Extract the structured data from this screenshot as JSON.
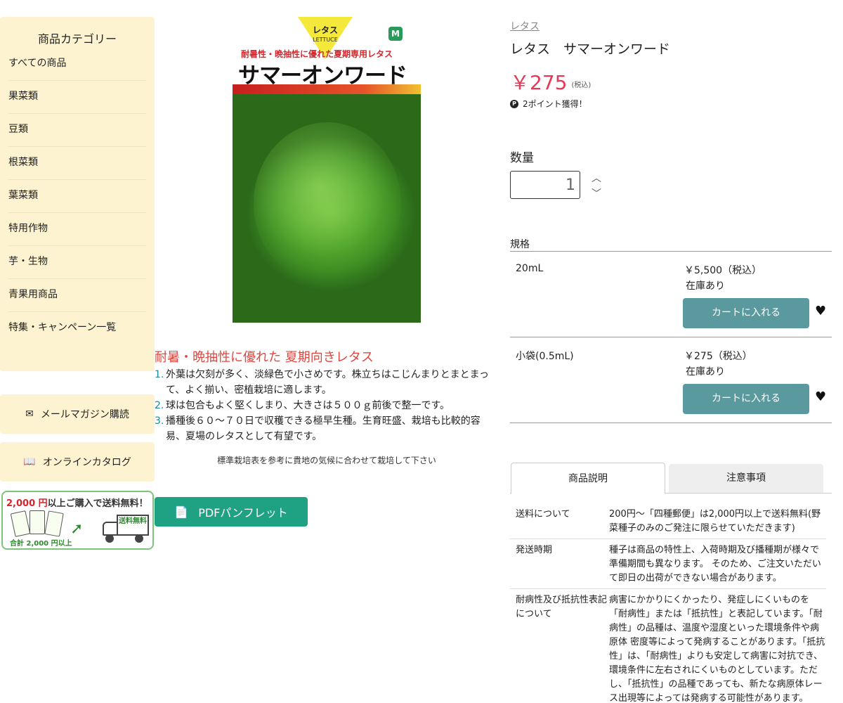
{
  "sidebar": {
    "title": "商品カテゴリー",
    "items": [
      "すべての商品",
      "果菜類",
      "豆類",
      "根菜類",
      "葉菜類",
      "特用作物",
      "芋・生物",
      "青果用商品",
      "特集・キャンペーン一覧"
    ],
    "mail_label": "メールマガジン購読",
    "catalog_label": "オンラインカタログ"
  },
  "banner": {
    "amount": "2,000 円",
    "text": "以上ご購入で送料無料！",
    "total": "合計 2,000 円以上",
    "truck_text": "送料無料"
  },
  "package": {
    "tag": "レタス",
    "tag_en": "LETTUCE",
    "subtitle": "耐暑性・晩抽性に優れた夏期専用レタス",
    "name": "サマーオンワード"
  },
  "description": {
    "title": "耐暑・晩抽性に優れた 夏期向きレタス",
    "points": [
      "外葉は欠刻が多く、淡緑色で小さめです。株立ちはこじんまりとまとまって、よく揃い、密植栽培に適します。",
      "球は包合もよく堅くしまり、大きさは５００ｇ前後で整一です。",
      "播種後６０～７０日で収穫できる極早生種。生育旺盛、栽培も比較的容易、夏場のレタスとして有望です。"
    ],
    "note": "標準栽培表を参考に貴地の気候に合わせて栽培して下さい",
    "pdf_label": "PDFパンフレット"
  },
  "product": {
    "breadcrumb": "レタス",
    "title": "レタス　サマーオンワード",
    "price": "￥275",
    "tax": "(税込)",
    "points": "2ポイント獲得！",
    "qty_label": "数量",
    "qty_value": "1",
    "spec_label": "規格",
    "specs": [
      {
        "name": "20mL",
        "price": "￥5,500（税込）",
        "stock": "在庫あり",
        "cart": "カートに入れる"
      },
      {
        "name": "小袋(0.5mL)",
        "price": "￥275（税込）",
        "stock": "在庫あり",
        "cart": "カートに入れる"
      }
    ]
  },
  "tabs": [
    "商品説明",
    "注意事項"
  ],
  "info": [
    {
      "k": "送料について",
      "v": "200円～「四種郵便」は2,000円以上で送料無料(野菜種子のみのご発注に限らせていただきます)"
    },
    {
      "k": "発送時期",
      "v": "種子は商品の特性上、入荷時期及び播種期が様々で準備期間も異なります。 そのため、ご注文いただいて即日の出荷ができない場合があります。"
    },
    {
      "k": "耐病性及び抵抗性表記について",
      "v": "病害にかかりにくかったり、発症しにくいものを「耐病性」または「抵抗性」と表記しています。「耐病性」の品種は、温度や湿度といった環境条件や病原体 密度等によって発病することがあります。「抵抗性」は、「耐病性」よりも安定して病害に対抗でき、環境条件に左右されにくいものとしています。ただし、「抵抗性」の品種であっても、新たな病原体レース出現等によっては発病する可能性があります。"
    }
  ]
}
